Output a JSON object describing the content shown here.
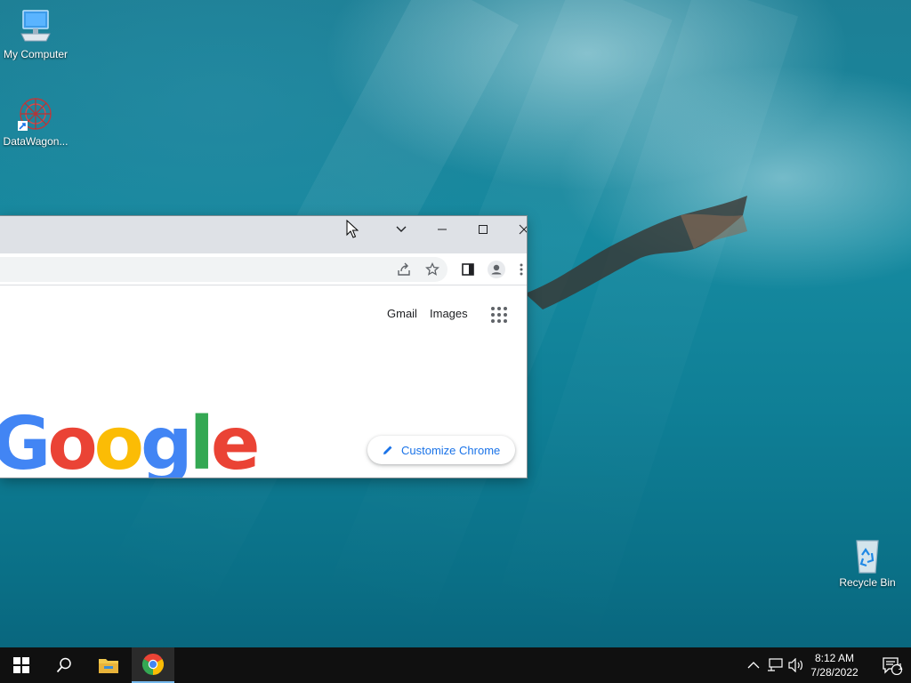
{
  "desktop": {
    "icons": [
      {
        "label": "My Computer",
        "icon": "computer-icon"
      },
      {
        "label": "DataWagon...",
        "icon": "datawagon-icon"
      },
      {
        "label": "Recycle Bin",
        "icon": "recycle-bin-icon"
      }
    ]
  },
  "browser": {
    "window_controls": {
      "tab_search": "chevron-down-icon",
      "minimize": "minimize-icon",
      "maximize": "maximize-icon",
      "close": "close-icon"
    },
    "toolbar": {
      "icons": [
        "share-icon",
        "star-icon",
        "side-panel-icon",
        "profile-icon",
        "menu-icon"
      ]
    },
    "page": {
      "links": [
        "Gmail",
        "Images"
      ],
      "apps_icon": "apps-grid-icon",
      "customize_label": "Customize Chrome",
      "logo_text": "Google",
      "logo_colors": [
        "#4285f4",
        "#ea4335",
        "#fbbc05",
        "#4285f4",
        "#34a853",
        "#ea4335"
      ]
    }
  },
  "taskbar": {
    "items": [
      "windows-start-icon",
      "search-icon",
      "file-explorer-icon",
      "chrome-icon"
    ],
    "tray": {
      "icons": [
        "chevron-up-icon",
        "network-icon",
        "volume-icon"
      ],
      "time": "8:12 AM",
      "date": "7/28/2022",
      "notification_count": "1"
    }
  }
}
